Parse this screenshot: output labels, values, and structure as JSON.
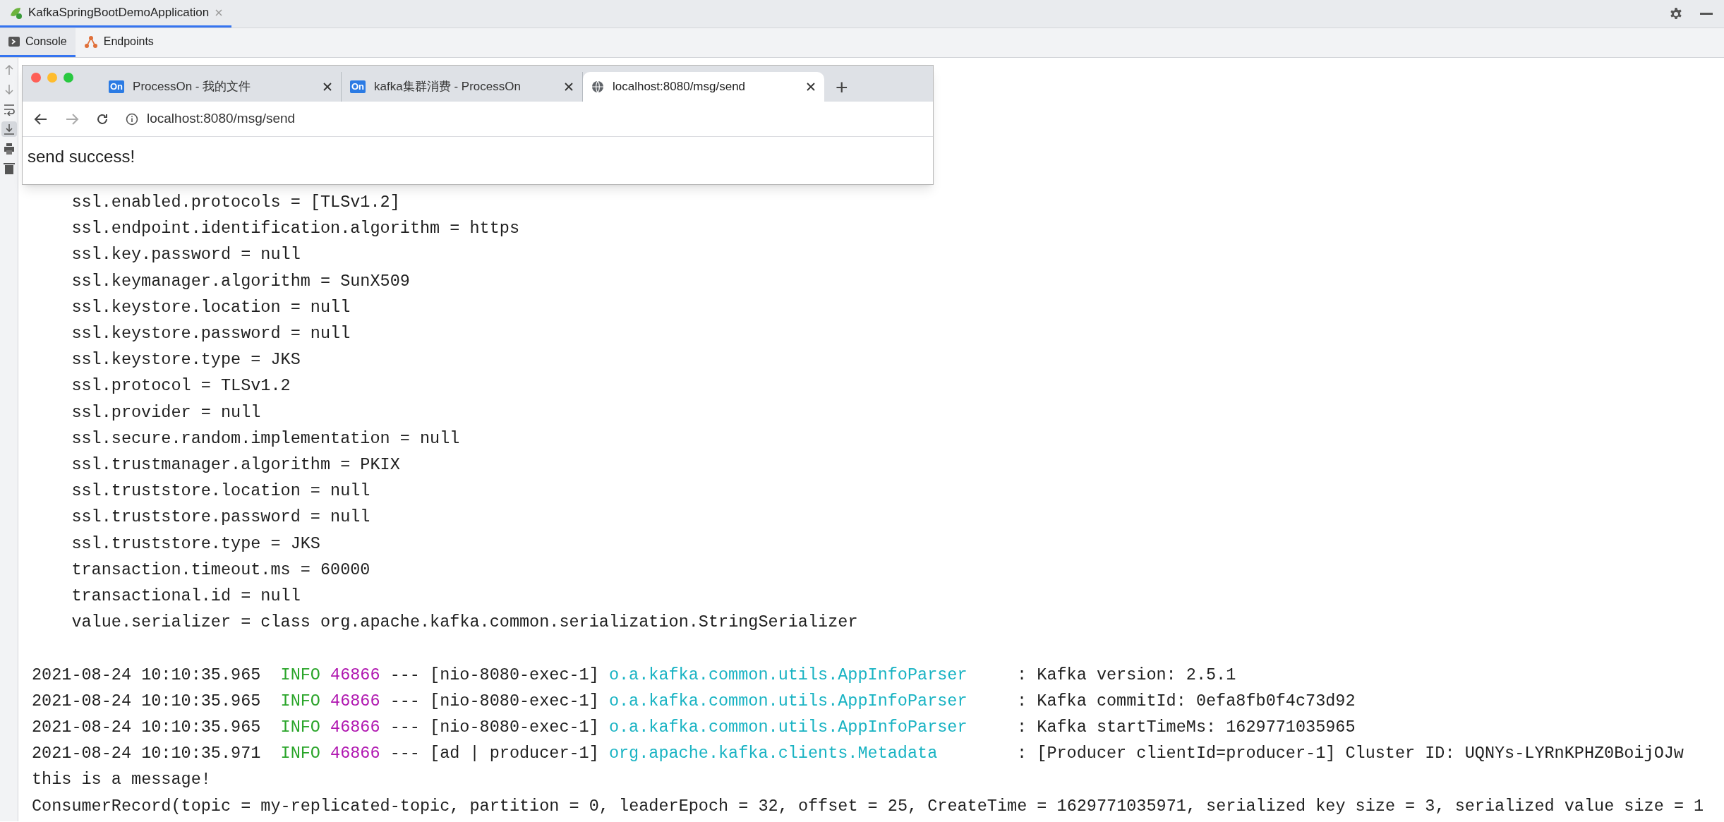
{
  "run_tab": {
    "label": "KafkaSpringBootDemoApplication",
    "selected": true
  },
  "tool_tabs": [
    {
      "label": "Console",
      "kind": "console",
      "selected": true
    },
    {
      "label": "Endpoints",
      "kind": "endpoints",
      "selected": false
    }
  ],
  "console_tools": [
    {
      "kind": "up",
      "selected": false
    },
    {
      "kind": "down",
      "selected": false
    },
    {
      "kind": "wrap",
      "selected": false
    },
    {
      "kind": "scroll-end",
      "selected": true
    },
    {
      "kind": "print",
      "selected": false
    },
    {
      "kind": "trash",
      "selected": false
    }
  ],
  "browser": {
    "tabs": [
      {
        "title": "ProcessOn - 我的文件",
        "kind": "processon",
        "icon_text": "On",
        "selected": false
      },
      {
        "title": "kafka集群消费 - ProcessOn",
        "kind": "processon",
        "icon_text": "On",
        "selected": false
      },
      {
        "title": "localhost:8080/msg/send",
        "kind": "globe",
        "selected": true
      }
    ],
    "new_tab": "+",
    "address": "localhost:8080/msg/send",
    "page_text": "send success!"
  },
  "console": {
    "lines": [
      {
        "kind": "config",
        "text": "ssl.enabled.protocols = [TLSv1.2]"
      },
      {
        "kind": "config",
        "text": "ssl.endpoint.identification.algorithm = https"
      },
      {
        "kind": "config",
        "text": "ssl.key.password = null"
      },
      {
        "kind": "config",
        "text": "ssl.keymanager.algorithm = SunX509"
      },
      {
        "kind": "config",
        "text": "ssl.keystore.location = null"
      },
      {
        "kind": "config",
        "text": "ssl.keystore.password = null"
      },
      {
        "kind": "config",
        "text": "ssl.keystore.type = JKS"
      },
      {
        "kind": "config",
        "text": "ssl.protocol = TLSv1.2"
      },
      {
        "kind": "config",
        "text": "ssl.provider = null"
      },
      {
        "kind": "config",
        "text": "ssl.secure.random.implementation = null"
      },
      {
        "kind": "config",
        "text": "ssl.trustmanager.algorithm = PKIX"
      },
      {
        "kind": "config",
        "text": "ssl.truststore.location = null"
      },
      {
        "kind": "config",
        "text": "ssl.truststore.password = null"
      },
      {
        "kind": "config",
        "text": "ssl.truststore.type = JKS"
      },
      {
        "kind": "config",
        "text": "transaction.timeout.ms = 60000"
      },
      {
        "kind": "config",
        "text": "transactional.id = null"
      },
      {
        "kind": "config",
        "text": "value.serializer = class org.apache.kafka.common.serialization.StringSerializer"
      },
      {
        "kind": "log",
        "timestamp": "2021-08-24 10:10:35.965",
        "level": "INFO",
        "pid": "46866",
        "separator": "---",
        "thread": "[nio-8080-exec-1]",
        "logger": "o.a.kafka.common.utils.AppInfoParser",
        "message": ": Kafka version: 2.5.1"
      },
      {
        "kind": "log",
        "timestamp": "2021-08-24 10:10:35.965",
        "level": "INFO",
        "pid": "46866",
        "separator": "---",
        "thread": "[nio-8080-exec-1]",
        "logger": "o.a.kafka.common.utils.AppInfoParser",
        "message": ": Kafka commitId: 0efa8fb0f4c73d92"
      },
      {
        "kind": "log",
        "timestamp": "2021-08-24 10:10:35.965",
        "level": "INFO",
        "pid": "46866",
        "separator": "---",
        "thread": "[nio-8080-exec-1]",
        "logger": "o.a.kafka.common.utils.AppInfoParser",
        "message": ": Kafka startTimeMs: 1629771035965"
      },
      {
        "kind": "log",
        "timestamp": "2021-08-24 10:10:35.971",
        "level": "INFO",
        "pid": "46866",
        "separator": "---",
        "thread": "[ad | producer-1]",
        "logger": "org.apache.kafka.clients.Metadata",
        "message": ": [Producer clientId=producer-1] Cluster ID: UQNYs-LYRnKPHZ0BoijOJw"
      },
      {
        "kind": "plain",
        "text": "this is a message!"
      },
      {
        "kind": "plain",
        "text": "ConsumerRecord(topic = my-replicated-topic, partition = 0, leaderEpoch = 32, offset = 25, CreateTime = 1629771035971, serialized key size = 3, serialized value size = 1"
      }
    ]
  }
}
